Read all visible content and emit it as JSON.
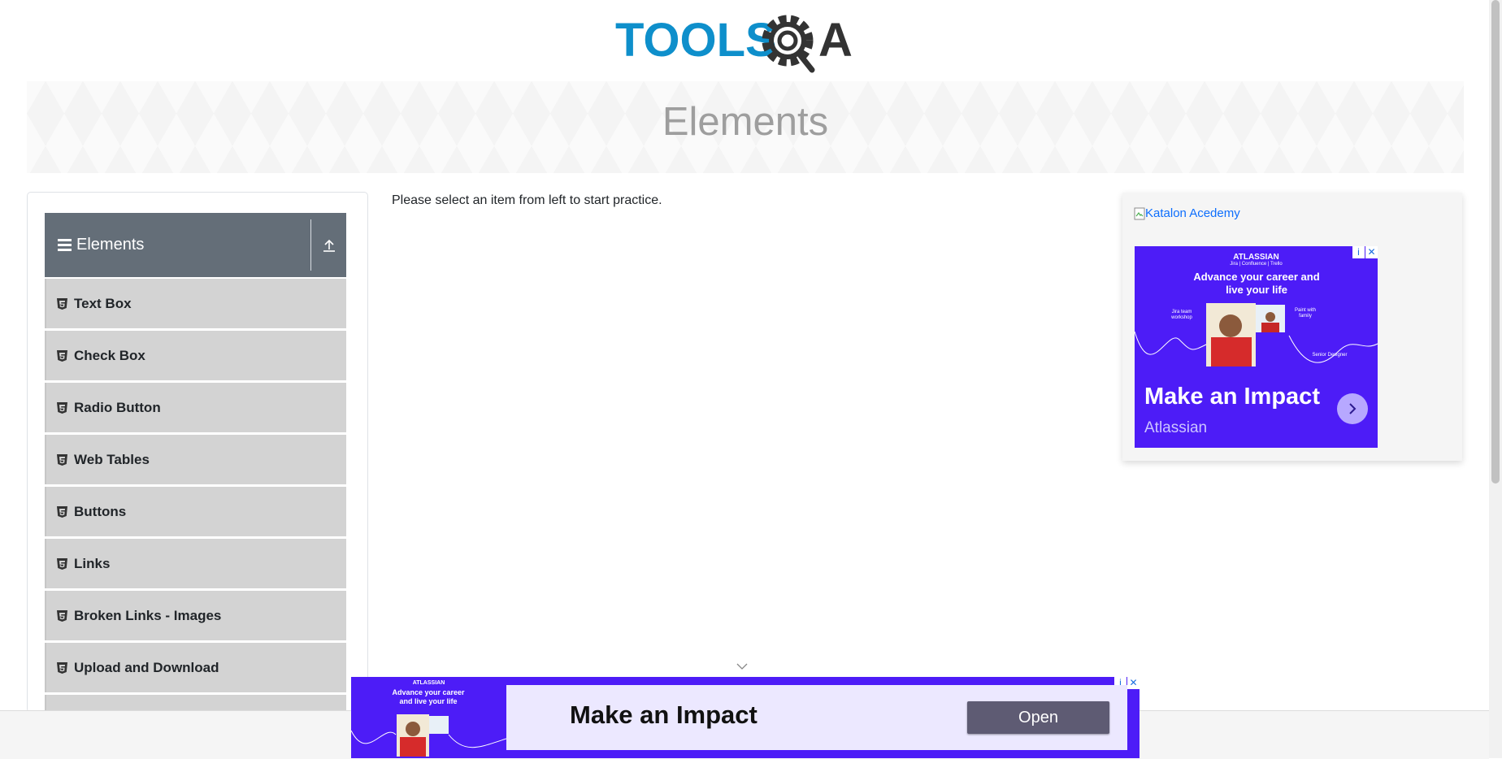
{
  "header": {
    "logo": {
      "text_left": "TOOLS",
      "text_right": "A",
      "color_blue": "#0e8fcb",
      "color_dark": "#333333"
    }
  },
  "banner": {
    "title": "Elements"
  },
  "sidebar": {
    "group": {
      "title": "Elements",
      "menu_icon": "hamburger-icon",
      "collapse_icon": "collapse-up-icon"
    },
    "items": [
      {
        "label": "Text Box",
        "icon": "html5-icon"
      },
      {
        "label": "Check Box",
        "icon": "html5-icon"
      },
      {
        "label": "Radio Button",
        "icon": "html5-icon"
      },
      {
        "label": "Web Tables",
        "icon": "html5-icon"
      },
      {
        "label": "Buttons",
        "icon": "html5-icon"
      },
      {
        "label": "Links",
        "icon": "html5-icon"
      },
      {
        "label": "Broken Links - Images",
        "icon": "html5-icon"
      },
      {
        "label": "Upload and Download",
        "icon": "html5-icon"
      }
    ]
  },
  "main": {
    "intro_text": "Please select an item from left to start practice."
  },
  "side_ad": {
    "image_alt": "Katalon Acedemy",
    "ad": {
      "brand": "ATLASSIAN",
      "products": "Jira | Confluence | Trello",
      "headline": "Advance your career and live your life",
      "note_left": "Jira team workshop",
      "note_right": "Paint with family",
      "note_sign": "Senior Designer",
      "title": "Make an Impact",
      "subtitle": "Atlassian",
      "info_label": "i",
      "close_label": "✕"
    }
  },
  "bottom_ad": {
    "brand": "ATLASSIAN",
    "headline": "Advance your career and live your life",
    "title": "Make an Impact",
    "button": "Open",
    "info_label": "i",
    "close_label": "✕"
  },
  "colors": {
    "sidebar_header": "#646e78",
    "menu_item_bg": "#d3d3d3",
    "ad_purple": "#4d1cf7",
    "banner_text": "#9e9e9e"
  }
}
